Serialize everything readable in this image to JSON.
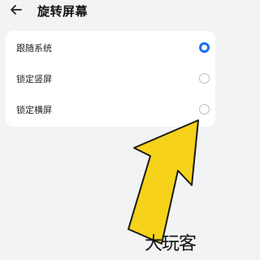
{
  "header": {
    "back_icon": "arrow-left-icon",
    "title": "旋转屏幕"
  },
  "options": [
    {
      "label": "跟随系统",
      "checked": true
    },
    {
      "label": "锁定竖屏",
      "checked": false
    },
    {
      "label": "锁定横屏",
      "checked": false
    }
  ],
  "colors": {
    "accent": "#1b6ff5",
    "arrow_fill": "#f6d21a",
    "background": "#f1f3f5"
  },
  "watermark": "大玩客"
}
